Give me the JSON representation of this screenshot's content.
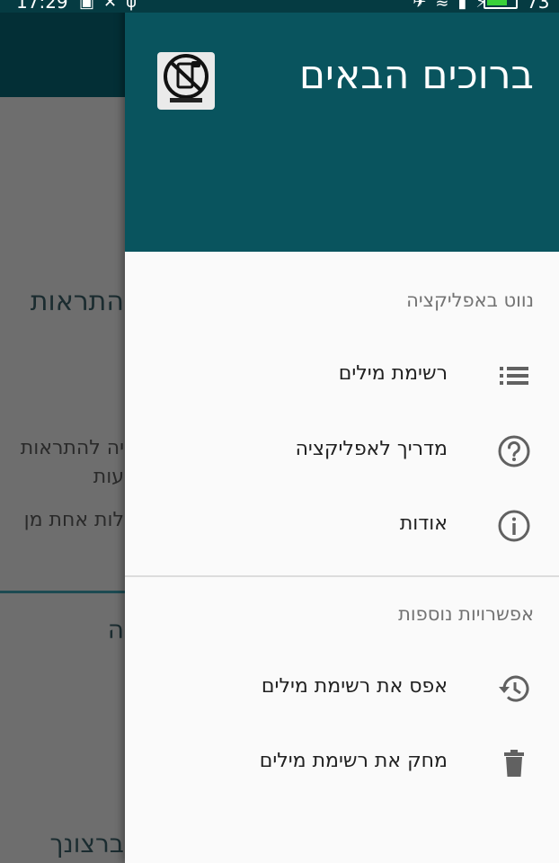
{
  "status_bar": {
    "time": "17:29",
    "battery_level": "73",
    "battery_color": "#38d13a"
  },
  "background_app": {
    "text_1": "התראות",
    "text_2": "יה להתראות",
    "text_3": "עות",
    "text_4": "לות אחת מן",
    "text_5": "ה",
    "text_6": "ברצונך"
  },
  "drawer": {
    "header_color": "#09545e",
    "title": "ברוכים הבאים",
    "logo_icon": "no-phone-logo-icon",
    "sections": [
      {
        "title": "נווט באפליקציה",
        "items": [
          {
            "label": "רשימת מילים",
            "icon": "list-icon"
          },
          {
            "label": "מדריך לאפליקציה",
            "icon": "help-circle-icon"
          },
          {
            "label": "אודות",
            "icon": "info-circle-icon"
          }
        ]
      },
      {
        "title": "אפשרויות נוספות",
        "items": [
          {
            "label": "אפס את רשימת מילים",
            "icon": "history-reset-icon"
          },
          {
            "label": "מחק את רשימת מילים",
            "icon": "trash-icon"
          }
        ]
      }
    ]
  }
}
